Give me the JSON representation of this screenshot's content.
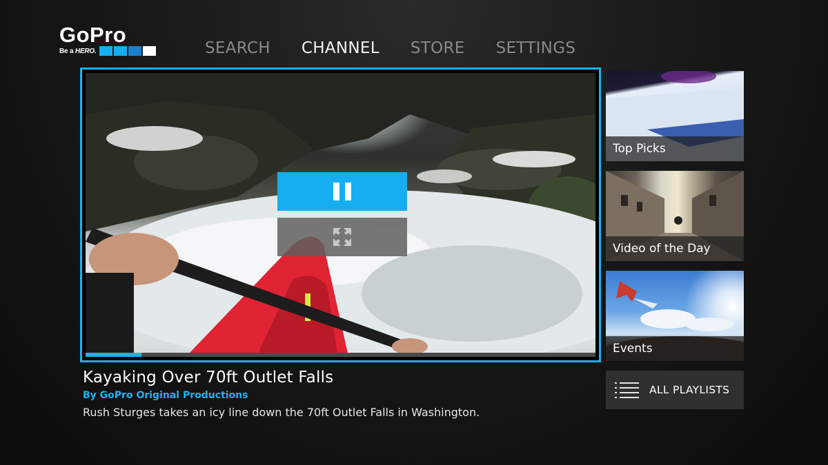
{
  "logo": {
    "wordmark": "GoPro",
    "tagline_prefix": "Be a",
    "tagline_emphasis": "HERO.",
    "square_colors": [
      "#16aef0",
      "#16aef0",
      "#1a7fd0",
      "#ffffff"
    ]
  },
  "nav": {
    "items": [
      {
        "label": "SEARCH",
        "active": false
      },
      {
        "label": "CHANNEL",
        "active": true
      },
      {
        "label": "STORE",
        "active": false
      },
      {
        "label": "SETTINGS",
        "active": false
      }
    ]
  },
  "player": {
    "progress": 0.11,
    "pause_icon": "pause-icon",
    "fullscreen_icon": "fullscreen-expand-icon",
    "accent": "#1ab3ef"
  },
  "video": {
    "title": "Kayaking Over 70ft Outlet Falls",
    "author": "By GoPro Original Productions",
    "description": "Rush Sturges takes an icy line down the 70ft Outlet Falls in Washington."
  },
  "sidebar": {
    "cards": [
      {
        "label": "Top Picks"
      },
      {
        "label": "Video of the Day"
      },
      {
        "label": "Events"
      }
    ],
    "playlists_label": "ALL PLAYLISTS",
    "playlists_icon": "list-icon"
  }
}
